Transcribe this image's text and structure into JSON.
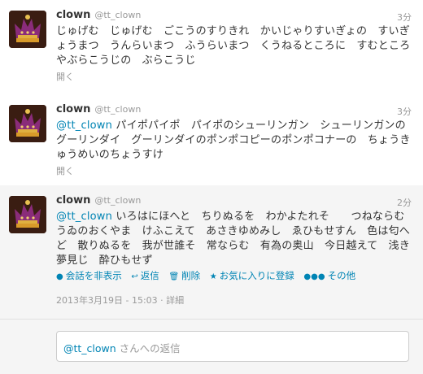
{
  "tweets": [
    {
      "name": "clown",
      "handle": "@tt_clown",
      "time": "3分",
      "mention": "",
      "text": "じゅげむ　じゅげむ　ごこうのすりきれ　かいじゃりすいぎょの　すいぎょうまつ　うんらいまつ　ふうらいまつ　くうねるところに　すむところ　やぶらこうじの　ぶらこうじ",
      "expand": "開く"
    },
    {
      "name": "clown",
      "handle": "@tt_clown",
      "time": "3分",
      "mention": "@tt_clown",
      "text": " パイポパイポ　パイポのシューリンガン　シューリンガンのグーリンダイ　グーリンダイのポンポコピーのポンポコナーの　ちょうきゅうめいのちょうすけ",
      "expand": "開く"
    },
    {
      "name": "clown",
      "handle": "@tt_clown",
      "time": "2分",
      "mention": "@tt_clown",
      "text": " いろはにほへと　ちりぬるを　わかよたれそ　　つねならむ　うゐのおくやま　けふこえて　あさきゆめみし　ゑひもせすん　色は匂へど　散りぬるを　我が世誰そ　常ならむ　有為の奥山　今日越えて　浅き夢見じ　酔ひもせず"
    }
  ],
  "actions": {
    "hide_conversation": "会話を非表示",
    "reply": "返信",
    "delete": "削除",
    "favorite": "お気に入りに登録",
    "more": "その他"
  },
  "meta": {
    "timestamp": "2013年3月19日 - 15:03",
    "separator": " · ",
    "details": "詳細"
  },
  "reply": {
    "mention": "@tt_clown",
    "placeholder": " さんへの返信"
  }
}
